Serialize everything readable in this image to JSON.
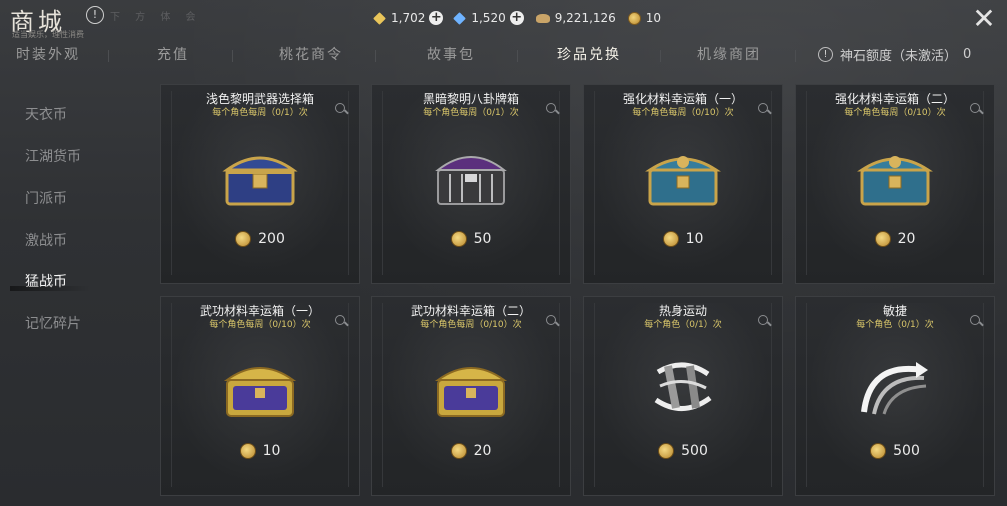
{
  "header": {
    "title": "商城",
    "subtitle": "适当娱乐，理性消费",
    "faded_text": "下 方 体 会"
  },
  "currencies": [
    {
      "icon": "gold-diamond-icon",
      "value": "1,702",
      "has_plus": true
    },
    {
      "icon": "blue-diamond-icon",
      "value": "1,520",
      "has_plus": true
    },
    {
      "icon": "silver-ingot-icon",
      "value": "9,221,126",
      "has_plus": false
    },
    {
      "icon": "gold-coin-icon",
      "value": "10",
      "has_plus": false
    }
  ],
  "tabs": [
    {
      "label": "时装外观"
    },
    {
      "label": "充值"
    },
    {
      "label": "桃花商令"
    },
    {
      "label": "故事包"
    },
    {
      "label": "珍品兑换",
      "active": true
    },
    {
      "label": "机缘商团"
    }
  ],
  "quota": {
    "label": "神石额度（未激活）",
    "value": "0"
  },
  "sidebar": {
    "items": [
      {
        "label": "天衣币"
      },
      {
        "label": "江湖货币"
      },
      {
        "label": "门派币"
      },
      {
        "label": "激战币"
      },
      {
        "label": "猛战币",
        "active": true
      },
      {
        "label": "记忆碎片"
      }
    ]
  },
  "items": [
    {
      "title": "浅色黎明武器选择箱",
      "limit": "每个角色每周（0/1）次",
      "price": "200",
      "art": "blue-gold-chest"
    },
    {
      "title": "黑暗黎明八卦牌箱",
      "limit": "每个角色每周（0/1）次",
      "price": "50",
      "art": "dark-purple-chest"
    },
    {
      "title": "强化材料幸运箱（一）",
      "limit": "每个角色每周（0/10）次",
      "price": "10",
      "art": "teal-chest"
    },
    {
      "title": "强化材料幸运箱（二）",
      "limit": "每个角色每周（0/10）次",
      "price": "20",
      "art": "teal-chest"
    },
    {
      "title": "武功材料幸运箱（一）",
      "limit": "每个角色每周（0/10）次",
      "price": "10",
      "art": "purple-gold-chest"
    },
    {
      "title": "武功材料幸运箱（二）",
      "limit": "每个角色每周（0/10）次",
      "price": "20",
      "art": "purple-gold-chest"
    },
    {
      "title": "热身运动",
      "limit": "每个角色（0/1）次",
      "price": "500",
      "art": "warmup-skill-icon"
    },
    {
      "title": "敏捷",
      "limit": "每个角色（0/1）次",
      "price": "500",
      "art": "agility-skill-icon"
    }
  ]
}
